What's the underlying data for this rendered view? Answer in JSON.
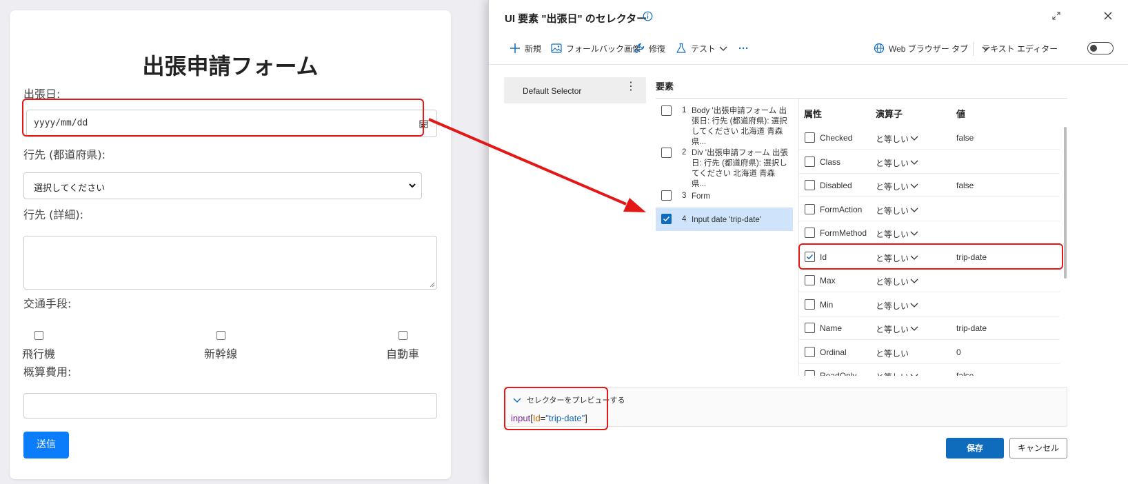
{
  "form": {
    "title": "出張申請フォーム",
    "date_label": "出張日:",
    "date_placeholder": "yyyy/mm/dd",
    "dest_pref_label": "行先 (都道府県):",
    "dest_pref_value": "選択してください",
    "dest_detail_label": "行先 (詳細):",
    "transport_label": "交通手段:",
    "transport_options": [
      "飛行機",
      "新幹線",
      "自動車"
    ],
    "cost_label": "概算費用:",
    "submit_label": "送信"
  },
  "dialog": {
    "title": "UI 要素 \"出張日\" のセレクター",
    "toolbar": {
      "new": "新規",
      "fallback": "フォールバック画像",
      "repair": "修復",
      "test": "テスト",
      "more": "···",
      "browser_tab": "Web ブラウザー タブ",
      "text_editor": "テキスト エディター"
    },
    "selector_name": "Default Selector",
    "elements_heading": "要素",
    "elements": [
      {
        "num": "1",
        "text": "Body '出張申請フォーム 出張日: 行先 (都道府県): 選択してください 北海道 青森県...",
        "checked": false
      },
      {
        "num": "2",
        "text": "Div '出張申請フォーム 出張日: 行先 (都道府県): 選択してください 北海道 青森県...",
        "checked": false
      },
      {
        "num": "3",
        "text": "Form",
        "checked": false
      },
      {
        "num": "4",
        "text": "Input date 'trip-date'",
        "checked": true
      }
    ],
    "attr_headers": {
      "attribute": "属性",
      "operator": "演算子",
      "value": "値"
    },
    "attributes": [
      {
        "name": "Checked",
        "op": "と等しい",
        "value": "false",
        "checked": false,
        "dropdown": true
      },
      {
        "name": "Class",
        "op": "と等しい",
        "value": "",
        "checked": false,
        "dropdown": true
      },
      {
        "name": "Disabled",
        "op": "と等しい",
        "value": "false",
        "checked": false,
        "dropdown": true
      },
      {
        "name": "FormAction",
        "op": "と等しい",
        "value": "",
        "checked": false,
        "dropdown": true
      },
      {
        "name": "FormMethod",
        "op": "と等しい",
        "value": "",
        "checked": false,
        "dropdown": true
      },
      {
        "name": "Id",
        "op": "と等しい",
        "value": "trip-date",
        "checked": true,
        "dropdown": true
      },
      {
        "name": "Max",
        "op": "と等しい",
        "value": "",
        "checked": false,
        "dropdown": true
      },
      {
        "name": "Min",
        "op": "と等しい",
        "value": "",
        "checked": false,
        "dropdown": true
      },
      {
        "name": "Name",
        "op": "と等しい",
        "value": "trip-date",
        "checked": false,
        "dropdown": true
      },
      {
        "name": "Ordinal",
        "op": "と等しい",
        "value": "0",
        "checked": false,
        "dropdown": false
      },
      {
        "name": "ReadOnly",
        "op": "と等しい",
        "value": "false",
        "checked": false,
        "dropdown": true
      }
    ],
    "preview_toggle": "セレクターをプレビューする",
    "preview_code": {
      "tag": "input",
      "attr": "Id",
      "value": "\"trip-date\""
    },
    "save_label": "保存",
    "cancel_label": "キャンセル"
  },
  "colors": {
    "accent": "#0f6cbd",
    "submit": "#0b7dfa",
    "highlight": "#e51616",
    "selected_row": "#cfe4fa"
  }
}
